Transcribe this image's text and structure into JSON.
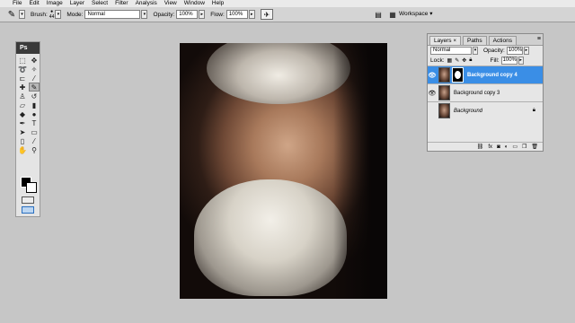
{
  "menu": [
    "File",
    "Edit",
    "Image",
    "Layer",
    "Select",
    "Filter",
    "Analysis",
    "View",
    "Window",
    "Help"
  ],
  "options_bar": {
    "brush_label": "Brush:",
    "brush_size": "44",
    "mode_label": "Mode:",
    "mode_value": "Normal",
    "opacity_label": "Opacity:",
    "opacity_value": "100%",
    "flow_label": "Flow:",
    "flow_value": "100%",
    "workspace_label": "Workspace"
  },
  "tools_panel": {
    "title": "Ps"
  },
  "layers_panel": {
    "tabs": [
      "Layers",
      "Paths",
      "Actions"
    ],
    "blend_mode": "Normal",
    "opacity_label": "Opacity:",
    "opacity_value": "100%",
    "lock_label": "Lock:",
    "fill_label": "Fill:",
    "fill_value": "100%",
    "layers": [
      {
        "name": "Background copy 4",
        "selected": true
      },
      {
        "name": "Background copy 3",
        "selected": false
      },
      {
        "name": "Background",
        "selected": false
      }
    ]
  },
  "colors": {
    "selection": "#3a8ee6",
    "workspace_bg": "#c6c6c6"
  }
}
